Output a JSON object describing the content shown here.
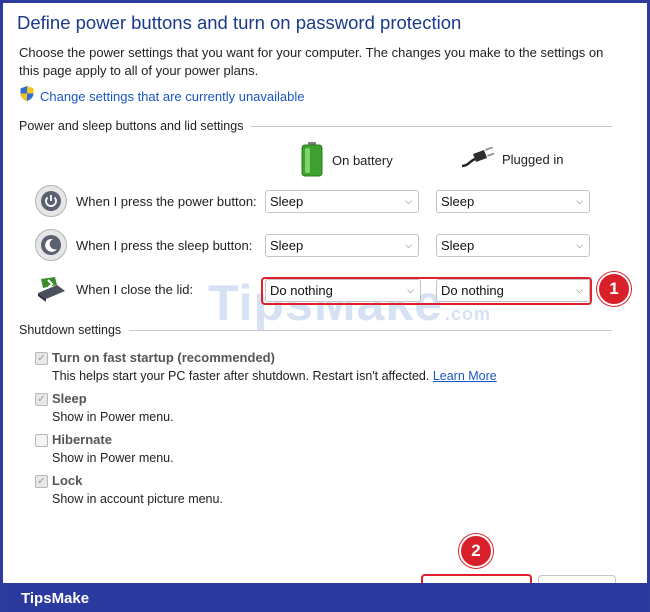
{
  "window": {
    "title": "Define power buttons and turn on password protection",
    "description": "Choose the power settings that you want for your computer. The changes you make to the settings on this page apply to all of your power plans.",
    "change_link": "Change settings that are currently unavailable"
  },
  "power_section": {
    "title": "Power and sleep buttons and lid settings",
    "col_battery": "On battery",
    "col_plugged": "Plugged in",
    "rows": [
      {
        "label": "When I press the power button:",
        "battery": "Sleep",
        "plugged": "Sleep",
        "icon": "power-button-icon"
      },
      {
        "label": "When I press the sleep button:",
        "battery": "Sleep",
        "plugged": "Sleep",
        "icon": "sleep-button-icon"
      },
      {
        "label": "When I close the lid:",
        "battery": "Do nothing",
        "plugged": "Do nothing",
        "icon": "laptop-lid-icon"
      }
    ]
  },
  "shutdown_section": {
    "title": "Shutdown settings",
    "options": [
      {
        "label": "Turn on fast startup (recommended)",
        "sub": "This helps start your PC faster after shutdown. Restart isn't affected.",
        "link": "Learn More",
        "checked": true
      },
      {
        "label": "Sleep",
        "sub": "Show in Power menu.",
        "checked": true
      },
      {
        "label": "Hibernate",
        "sub": "Show in Power menu.",
        "checked": false
      },
      {
        "label": "Lock",
        "sub": "Show in account picture menu.",
        "checked": true
      }
    ]
  },
  "annotations": {
    "callout_1": "1",
    "callout_2": "2"
  },
  "watermark": {
    "main": "TipsMake",
    "suffix": ".com"
  },
  "footer": {
    "brand": "TipsMake"
  },
  "colors": {
    "title": "#1a3a8a",
    "link": "#1a56c4",
    "highlight": "#e0202a",
    "footer": "#2a3a9e"
  }
}
